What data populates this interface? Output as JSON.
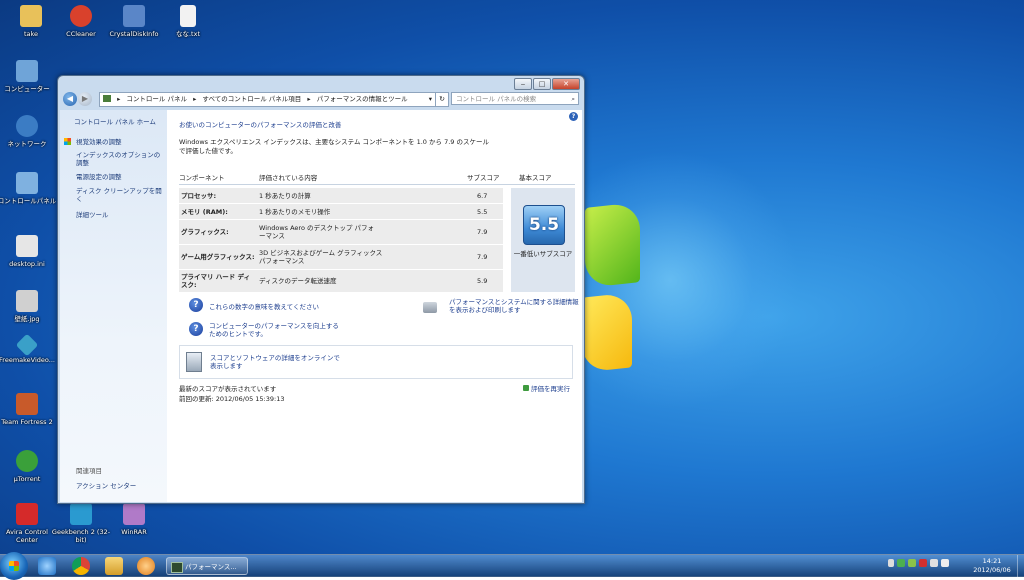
{
  "desktop_icons": [
    {
      "label": "take",
      "color": "#e8c15a"
    },
    {
      "label": "CCleaner",
      "color": "#d9412c"
    },
    {
      "label": "CrystalDiskInfo",
      "color": "#5a86c8"
    },
    {
      "label": "なな.txt",
      "color": "#f2f2f2"
    },
    {
      "label": "コンピューター",
      "color": "#6fa4d8"
    },
    {
      "label": "ネットワーク",
      "color": "#3b7cc4"
    },
    {
      "label": "コントロールパネル",
      "color": "#7fb1e0"
    },
    {
      "label": "desktop.ini",
      "color": "#e6e6e6"
    },
    {
      "label": "壁紙.jpg",
      "color": "#d0d0d0"
    },
    {
      "label": "FreemakeVideo...",
      "color": "#3aa0c8"
    },
    {
      "label": "Team Fortress 2",
      "color": "#c85a2a"
    },
    {
      "label": "µTorrent",
      "color": "#3aa03a"
    },
    {
      "label": "Avira Control Center",
      "color": "#d52a2a"
    },
    {
      "label": "Geekbench 2 (32-bit)",
      "color": "#2a9ad0"
    },
    {
      "label": "WinRAR",
      "color": "#b07ac8"
    }
  ],
  "window": {
    "buttons": {
      "minimize": "‒",
      "maximize": "□",
      "close": "✕"
    },
    "address": {
      "icon": "control-panel-icon",
      "crumbs": [
        "▸",
        "コントロール パネル",
        "▸",
        "すべてのコントロール パネル項目",
        "▸",
        "パフォーマンスの情報とツール"
      ],
      "dropdown": "▾",
      "refresh": "↻"
    },
    "search_placeholder": "コントロール パネルの検索",
    "nav": {
      "home": "コントロール パネル ホーム",
      "items": [
        "視覚効果の調整",
        "インデックスのオプションの調整",
        "電源設定の調整",
        "ディスク クリーンアップを開く",
        "詳細ツール"
      ],
      "see_also_title": "関連項目",
      "see_also_item": "アクション センター"
    },
    "content": {
      "heading": "お使いのコンピューターのパフォーマンスの評価と改善",
      "description": "Windows エクスペリエンス インデックスは、主要なシステム コンポーネントを 1.0 から 7.9 のスケールで評価した値です。",
      "columns": {
        "component": "コンポーネント",
        "rating": "評価されている内容",
        "subscore": "サブスコア",
        "base": "基本スコア"
      },
      "rows": [
        {
          "component": "プロセッサ:",
          "rating": "1 秒あたりの計算",
          "score": "6.7"
        },
        {
          "component": "メモリ (RAM):",
          "rating": "1 秒あたりのメモリ操作",
          "score": "5.5"
        },
        {
          "component": "グラフィックス:",
          "rating": "Windows Aero のデスクトップ パフォーマンス",
          "score": "7.9"
        },
        {
          "component": "ゲーム用グラフィックス:",
          "rating": "3D ビジネスおよびゲーム グラフィックスパフォーマンス",
          "score": "7.9"
        },
        {
          "component": "プライマリ ハード ディスク:",
          "rating": "ディスクのデータ転送速度",
          "score": "5.9"
        }
      ],
      "base_score": "5.5",
      "base_caption": "一番低いサブスコア",
      "links": {
        "q1": "これらの数字の意味を教えてください",
        "q2": "コンピューターのパフォーマンスを向上するためのヒントです。",
        "print": "パフォーマンスとシステムに関する詳細情報を表示および印刷します",
        "online": "スコアとソフトウェアの詳細をオンラインで表示します"
      },
      "footer": {
        "status": "最新のスコアが表示されています",
        "last_update": "前回の更新: 2012/06/05 15:39:13",
        "rerun": "評価を再実行"
      }
    }
  },
  "taskbar": {
    "task_label": "パフォーマンス...",
    "clock_time": "14:21",
    "clock_date": "2012/06/06"
  }
}
